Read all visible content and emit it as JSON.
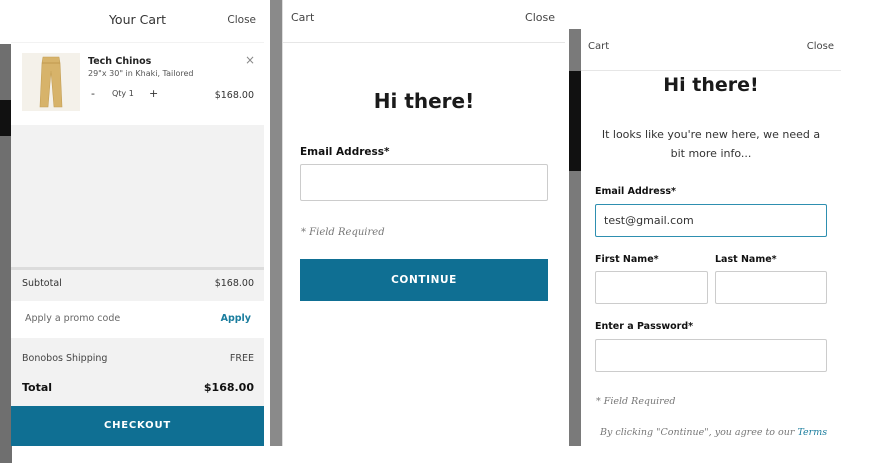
{
  "cart": {
    "title": "Your Cart",
    "close_label": "Close",
    "item": {
      "name": "Tech Chinos",
      "description": "29\"x 30\" in Khaki, Tailored",
      "qty_minus": "-",
      "qty_label": "Qty 1",
      "qty_plus": "+",
      "price": "$168.00",
      "remove": "×"
    },
    "subtotal_label": "Subtotal",
    "subtotal_value": "$168.00",
    "promo_label": "Apply a promo code",
    "promo_apply": "Apply",
    "shipping_label": "Bonobos Shipping",
    "shipping_value": "FREE",
    "total_label": "Total",
    "total_value": "$168.00",
    "checkout_label": "CHECKOUT",
    "colors": {
      "accent": "#0f6f93",
      "link": "#1a7d9e",
      "bg": "#f2f2f2"
    }
  },
  "signin": {
    "header_left": "Cart",
    "header_right": "Close",
    "greeting": "Hi there!",
    "email_label": "Email Address*",
    "email_value": "",
    "required_note": "* Field Required",
    "continue_label": "CONTINUE"
  },
  "signup": {
    "header_left": "Cart",
    "header_right": "Close",
    "greeting": "Hi there!",
    "subtitle": "It looks like you're new here, we need a bit more info...",
    "email_label": "Email Address*",
    "email_value": "test@gmail.com",
    "first_name_label": "First Name*",
    "first_name_value": "",
    "last_name_label": "Last Name*",
    "last_name_value": "",
    "password_label": "Enter a Password*",
    "password_value": "",
    "required_note": "* Field Required",
    "terms_prefix": "By clicking \"Continue\", you agree to our",
    "terms_link": "Terms"
  }
}
